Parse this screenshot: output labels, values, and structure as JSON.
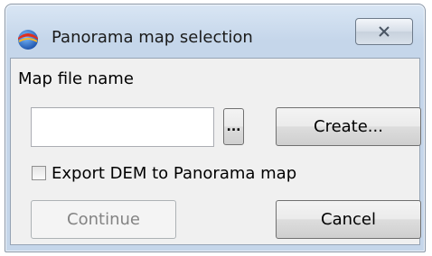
{
  "window": {
    "title": "Panorama map selection"
  },
  "form": {
    "map_file_label": "Map file name",
    "map_file_value": "",
    "browse_label": "...",
    "create_label": "Create...",
    "export_label": "Export DEM to Panorama map",
    "export_checked": false
  },
  "actions": {
    "continue_label": "Continue",
    "cancel_label": "Cancel"
  },
  "icons": {
    "title": "panorama-globe-icon",
    "close": "close-icon"
  }
}
